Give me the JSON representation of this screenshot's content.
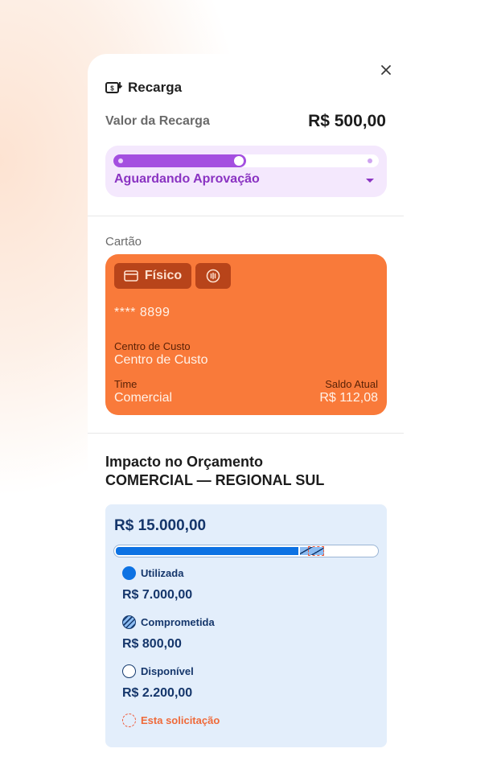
{
  "header": {
    "title": "Recarga",
    "icon": "money-in-icon",
    "close_icon": "close-icon"
  },
  "recharge": {
    "label": "Valor da Recarga",
    "amount": "R$ 500,00"
  },
  "status": {
    "text": "Aguardando Aprovação",
    "progress": 0.5,
    "color": "#a44fe0"
  },
  "card_section": {
    "label": "Cartão",
    "chip_type": "Físico",
    "chip_icon": "credit-card-icon",
    "nfc_icon": "contactless-icon",
    "number": "**** 8899",
    "cost_center_label": "Centro de Custo",
    "cost_center_value": "Centro de Custo",
    "team_label": "Time",
    "team_value": "Comercial",
    "balance_label": "Saldo Atual",
    "balance_value": "R$ 112,08",
    "color": "#f97a3a"
  },
  "budget": {
    "title_line1": "Impacto no Orçamento",
    "title_line2": "COMERCIAL — REGIONAL SUL",
    "total": "R$ 15.000,00",
    "total_amount": 15000,
    "used_amount": 7000,
    "committed_amount": 800,
    "request_amount": 500,
    "legend": {
      "used_label": "Utilizada",
      "used_value": "R$ 7.000,00",
      "committed_label": "Comprometida",
      "committed_value": "R$ 800,00",
      "available_label": "Disponível",
      "available_value": "R$ 2.200,00",
      "request_label": "Esta solicitação"
    },
    "colors": {
      "used": "#0d72e3",
      "committed": "#8cbcf2",
      "request": "#ef5a3a",
      "text": "#15366b"
    }
  }
}
